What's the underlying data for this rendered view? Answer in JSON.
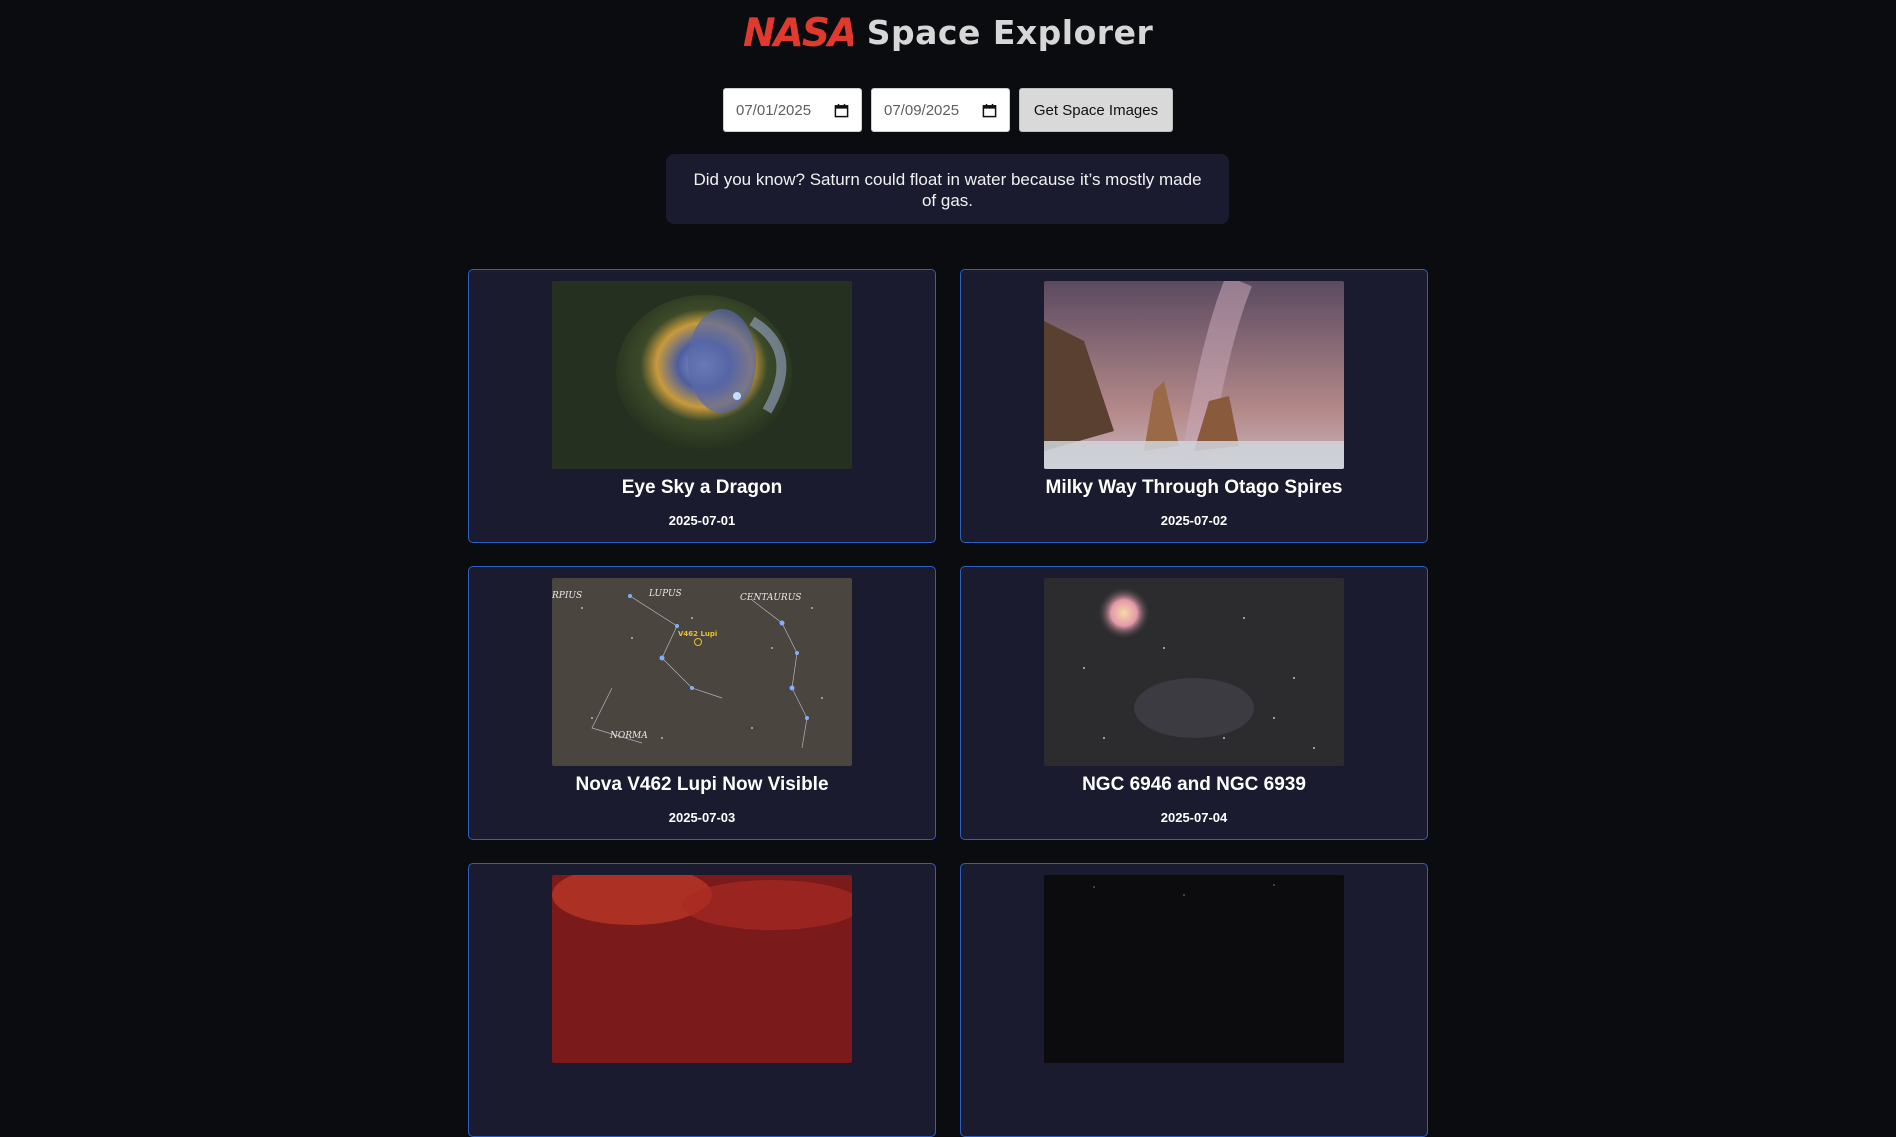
{
  "header": {
    "logo_text": "NASA",
    "logo_color": "#e03a2f",
    "title": "Space Explorer"
  },
  "controls": {
    "start_date": "07/01/2025",
    "end_date": "07/09/2025",
    "button_label": "Get Space Images"
  },
  "fact": {
    "text": "Did you know? Saturn could float in water because it’s mostly made of gas."
  },
  "gallery": {
    "items": [
      {
        "title": "Eye Sky a Dragon",
        "date": "2025-07-01"
      },
      {
        "title": "Milky Way Through Otago Spires",
        "date": "2025-07-02"
      },
      {
        "title": "Nova V462 Lupi Now Visible",
        "date": "2025-07-03",
        "labels": [
          "LUPUS",
          "CENTAURUS",
          "V462 Lupi",
          "NORMA",
          "RPIUS"
        ]
      },
      {
        "title": "NGC 6946 and NGC 6939",
        "date": "2025-07-04"
      },
      {
        "title": "",
        "date": ""
      },
      {
        "title": "",
        "date": ""
      }
    ]
  },
  "colors": {
    "background": "#0b0c10",
    "card_background": "#1a1b2e",
    "card_border": "#2d5fc4"
  }
}
